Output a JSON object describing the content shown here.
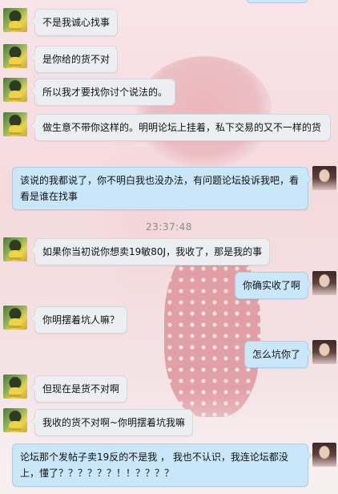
{
  "messages": [
    {
      "from": "them",
      "text": "不是我诚心找事"
    },
    {
      "from": "them",
      "text": "是你给的货不对"
    },
    {
      "from": "them",
      "text": "所以我才要找你讨个说法的。"
    },
    {
      "from": "them",
      "text": "做生意不带你这样的。明明论坛上挂着，私下交易的又不一样的货"
    },
    {
      "from": "me",
      "text": "该说的我都说了，你不明白我也没办法，有问题论坛投诉我吧，看看是谁在找事"
    },
    {
      "from": "them",
      "text": "如果你当初说你想卖19敏80J，我收了，那是我的事"
    },
    {
      "from": "me",
      "text": "你确实收了啊"
    },
    {
      "from": "them",
      "text": "你明摆着坑人嘛？"
    },
    {
      "from": "me",
      "text": "怎么坑你了"
    },
    {
      "from": "them",
      "text": "但现在是货不对啊"
    },
    {
      "from": "them",
      "text": "我收的货不对啊~你明摆着坑我嘛"
    },
    {
      "from": "me",
      "text": "论坛那个发帖子卖19反的不是我 ， 我也不认识，我连论坛都没上，懂了？？？？？？！！？？？？"
    }
  ],
  "timestamp": "23:37:48"
}
